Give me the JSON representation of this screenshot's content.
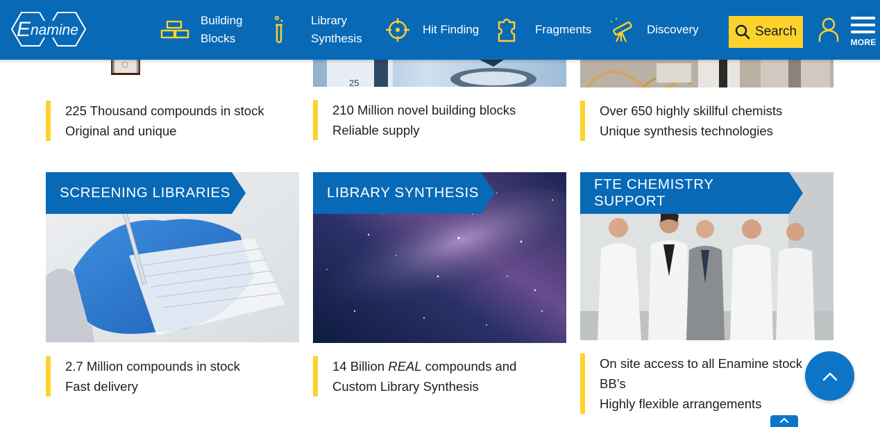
{
  "brand": {
    "name": "Enamine"
  },
  "nav": {
    "items": [
      {
        "label": "Building\nBlocks",
        "icon": "building-blocks-icon"
      },
      {
        "label": "Library\nSynthesis",
        "icon": "test-tube-icon"
      },
      {
        "label": "Hit Finding",
        "icon": "crosshair-icon"
      },
      {
        "label": "Fragments",
        "icon": "puzzle-piece-icon"
      },
      {
        "label": "Discovery",
        "icon": "telescope-icon"
      }
    ],
    "search_label": "Search",
    "more_label": "MORE"
  },
  "top_row": [
    {
      "line1": "225 Thousand compounds in stock",
      "line2": "Original and unique"
    },
    {
      "line1": "210 Million novel building blocks",
      "line2": "Reliable supply"
    },
    {
      "line1": "Over 650 highly skillful chemists",
      "line2": "Unique synthesis technologies"
    }
  ],
  "cards": [
    {
      "title": "SCREENING LIBRARIES",
      "line1": "2.7 Million compounds in stock",
      "line2": "Fast delivery"
    },
    {
      "title": "LIBRARY SYNTHESIS",
      "line1_a": "14 Billion ",
      "line1_em": "REAL",
      "line1_b": " compounds and",
      "line2": "Custom Library Synthesis"
    },
    {
      "title": "FTE CHEMISTRY SUPPORT",
      "line1": "On site access to all Enamine stock",
      "line2": "BB’s",
      "line3": "Highly flexible arrangements"
    }
  ],
  "colors": {
    "brand_blue": "#0869b6",
    "accent_yellow": "#fdd22b"
  }
}
